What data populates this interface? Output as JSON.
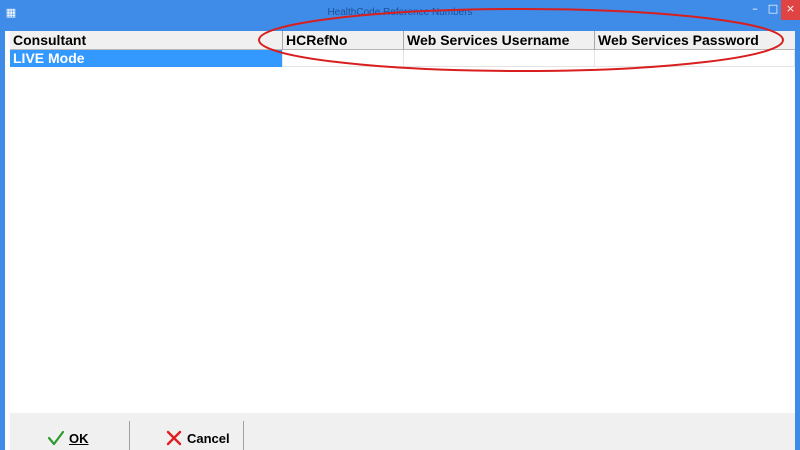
{
  "window": {
    "title": "HealthCode Reference Numbers",
    "app_icon": "app-icon",
    "controls": {
      "minimize": "–",
      "maximize": "□",
      "close": "×"
    }
  },
  "grid": {
    "columns": [
      "Consultant",
      "HCRefNo",
      "Web Services Username",
      "Web Services Password"
    ],
    "rows": [
      {
        "consultant": "LIVE Mode",
        "hcrefno": "",
        "ws_username": "",
        "ws_password": ""
      }
    ],
    "selected_row_color": "#3399ff"
  },
  "buttons": {
    "ok": {
      "label": "OK",
      "icon": "checkmark-icon",
      "color": "#2e9a2e"
    },
    "cancel": {
      "label": "Cancel",
      "icon": "x-icon",
      "color": "#e02020"
    }
  },
  "annotation": {
    "shape": "ellipse",
    "color": "#d81e1e"
  }
}
